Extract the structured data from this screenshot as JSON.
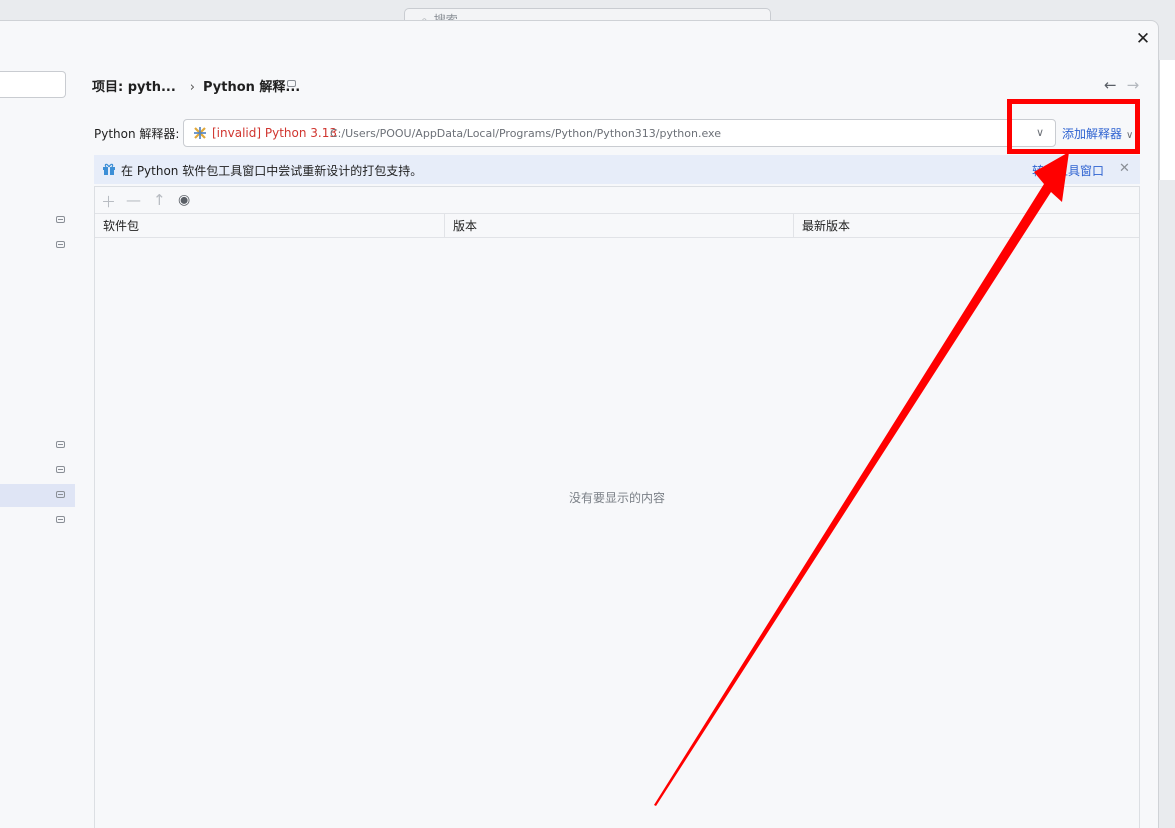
{
  "background": {
    "search_placeholder": "搜索"
  },
  "dialog": {
    "close_icon": "close-icon"
  },
  "breadcrumb": {
    "project": "项目: pyth...",
    "page": "Python 解释..."
  },
  "interpreter": {
    "label": "Python 解释器:",
    "invalid_name": "[invalid] Python 3.13",
    "path": "C:/Users/POOU/AppData/Local/Programs/Python/Python313/python.exe",
    "add_button": "添加解释器"
  },
  "banner": {
    "text": "在 Python 软件包工具窗口中尝试重新设计的打包支持。",
    "link": "转到工具窗口"
  },
  "packages": {
    "columns": [
      "软件包",
      "版本",
      "最新版本"
    ],
    "empty_text": "没有要显示的内容"
  },
  "colors": {
    "annotation": "#ff0000",
    "link": "#2f63d1",
    "invalid": "#d0352f"
  }
}
